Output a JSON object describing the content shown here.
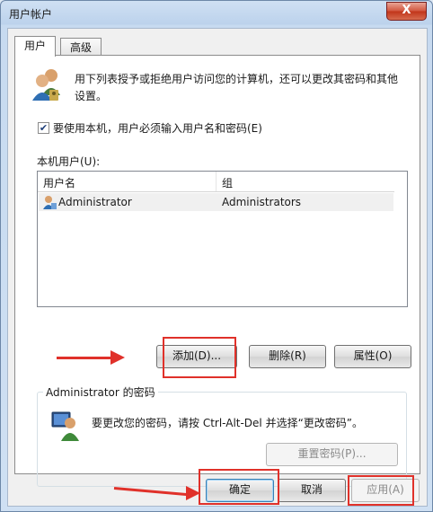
{
  "window": {
    "title": "用户帐户",
    "close_glyph": "X"
  },
  "tabs": [
    {
      "label": "用户"
    },
    {
      "label": "高级"
    }
  ],
  "intro_text_line1": "用下列表授予或拒绝用户访问您的计算机，还可以更改其密码和其他",
  "intro_text_line2": "设置。",
  "require_login": {
    "label": "要使用本机，用户必须输入用户名和密码(E)",
    "checked": true
  },
  "local_users_label": "本机用户(U):",
  "list": {
    "columns": [
      "用户名",
      "组"
    ],
    "rows": [
      {
        "username": "Administrator",
        "group": "Administrators"
      }
    ]
  },
  "buttons": {
    "add": "添加(D)...",
    "remove": "删除(R)",
    "properties": "属性(O)"
  },
  "password_group": {
    "title": "Administrator 的密码",
    "text": "要更改您的密码，请按 Ctrl-Alt-Del 并选择“更改密码”。",
    "reset_button": "重置密码(P)..."
  },
  "footer": {
    "ok": "确定",
    "cancel": "取消",
    "apply": "应用(A)"
  },
  "colors": {
    "annotation_red": "#e0312a",
    "title_bar": "#bcd2ec"
  }
}
